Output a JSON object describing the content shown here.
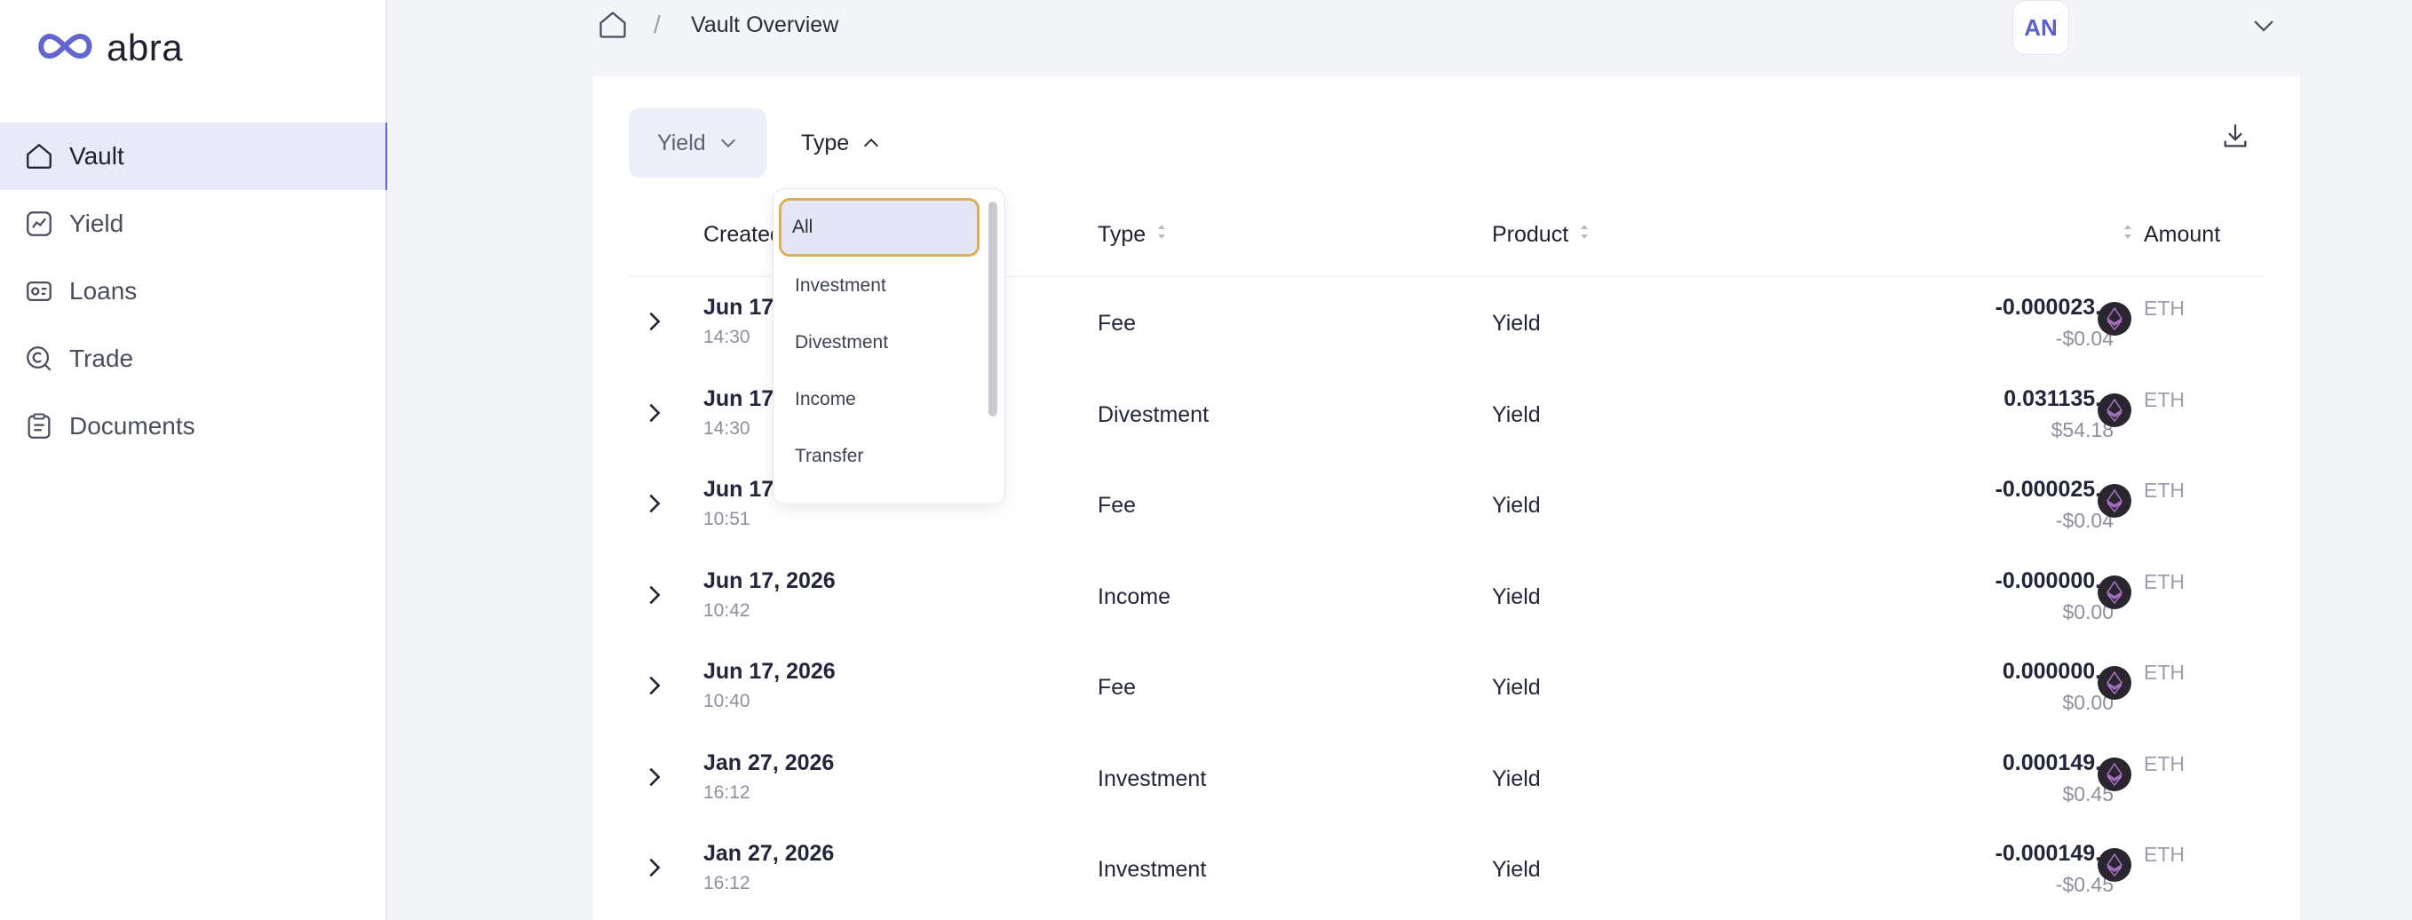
{
  "brand": {
    "name": "abra",
    "accent": "#6366d1"
  },
  "sidebar": {
    "items": [
      {
        "label": "Vault",
        "icon": "home-icon",
        "active": true
      },
      {
        "label": "Yield",
        "icon": "chart-icon",
        "active": false
      },
      {
        "label": "Loans",
        "icon": "loans-icon",
        "active": false
      },
      {
        "label": "Trade",
        "icon": "trade-icon",
        "active": false
      },
      {
        "label": "Documents",
        "icon": "documents-icon",
        "active": false
      }
    ]
  },
  "header": {
    "breadcrumb_separator": "/",
    "title": "Vault Overview",
    "avatar_initials": "AN"
  },
  "filters": {
    "yield_label": "Yield",
    "type_label": "Type"
  },
  "type_dropdown": {
    "options": [
      "All",
      "Investment",
      "Divestment",
      "Income",
      "Transfer"
    ],
    "selected": "All"
  },
  "table": {
    "columns": {
      "created": "Created",
      "type": "Type",
      "product": "Product",
      "amount": "Amount"
    },
    "rows": [
      {
        "date": "Jun 17,",
        "time": "14:30",
        "type": "Fee",
        "product": "Yield",
        "amount": "-0.000023...",
        "usd": "-$0.04",
        "asset": "ETH"
      },
      {
        "date": "Jun 17,",
        "time": "14:30",
        "type": "Divestment",
        "product": "Yield",
        "amount": "0.031135...",
        "usd": "$54.18",
        "asset": "ETH"
      },
      {
        "date": "Jun 17,",
        "time": "10:51",
        "type": "Fee",
        "product": "Yield",
        "amount": "-0.000025...",
        "usd": "-$0.04",
        "asset": "ETH"
      },
      {
        "date": "Jun 17, 2026",
        "time": "10:42",
        "type": "Income",
        "product": "Yield",
        "amount": "-0.000000...",
        "usd": "$0.00",
        "asset": "ETH"
      },
      {
        "date": "Jun 17, 2026",
        "time": "10:40",
        "type": "Fee",
        "product": "Yield",
        "amount": "0.000000...",
        "usd": "$0.00",
        "asset": "ETH"
      },
      {
        "date": "Jan 27, 2026",
        "time": "16:12",
        "type": "Investment",
        "product": "Yield",
        "amount": "0.000149...",
        "usd": "$0.45",
        "asset": "ETH"
      },
      {
        "date": "Jan 27, 2026",
        "time": "16:12",
        "type": "Investment",
        "product": "Yield",
        "amount": "-0.000149...",
        "usd": "-$0.45",
        "asset": "ETH"
      }
    ]
  }
}
